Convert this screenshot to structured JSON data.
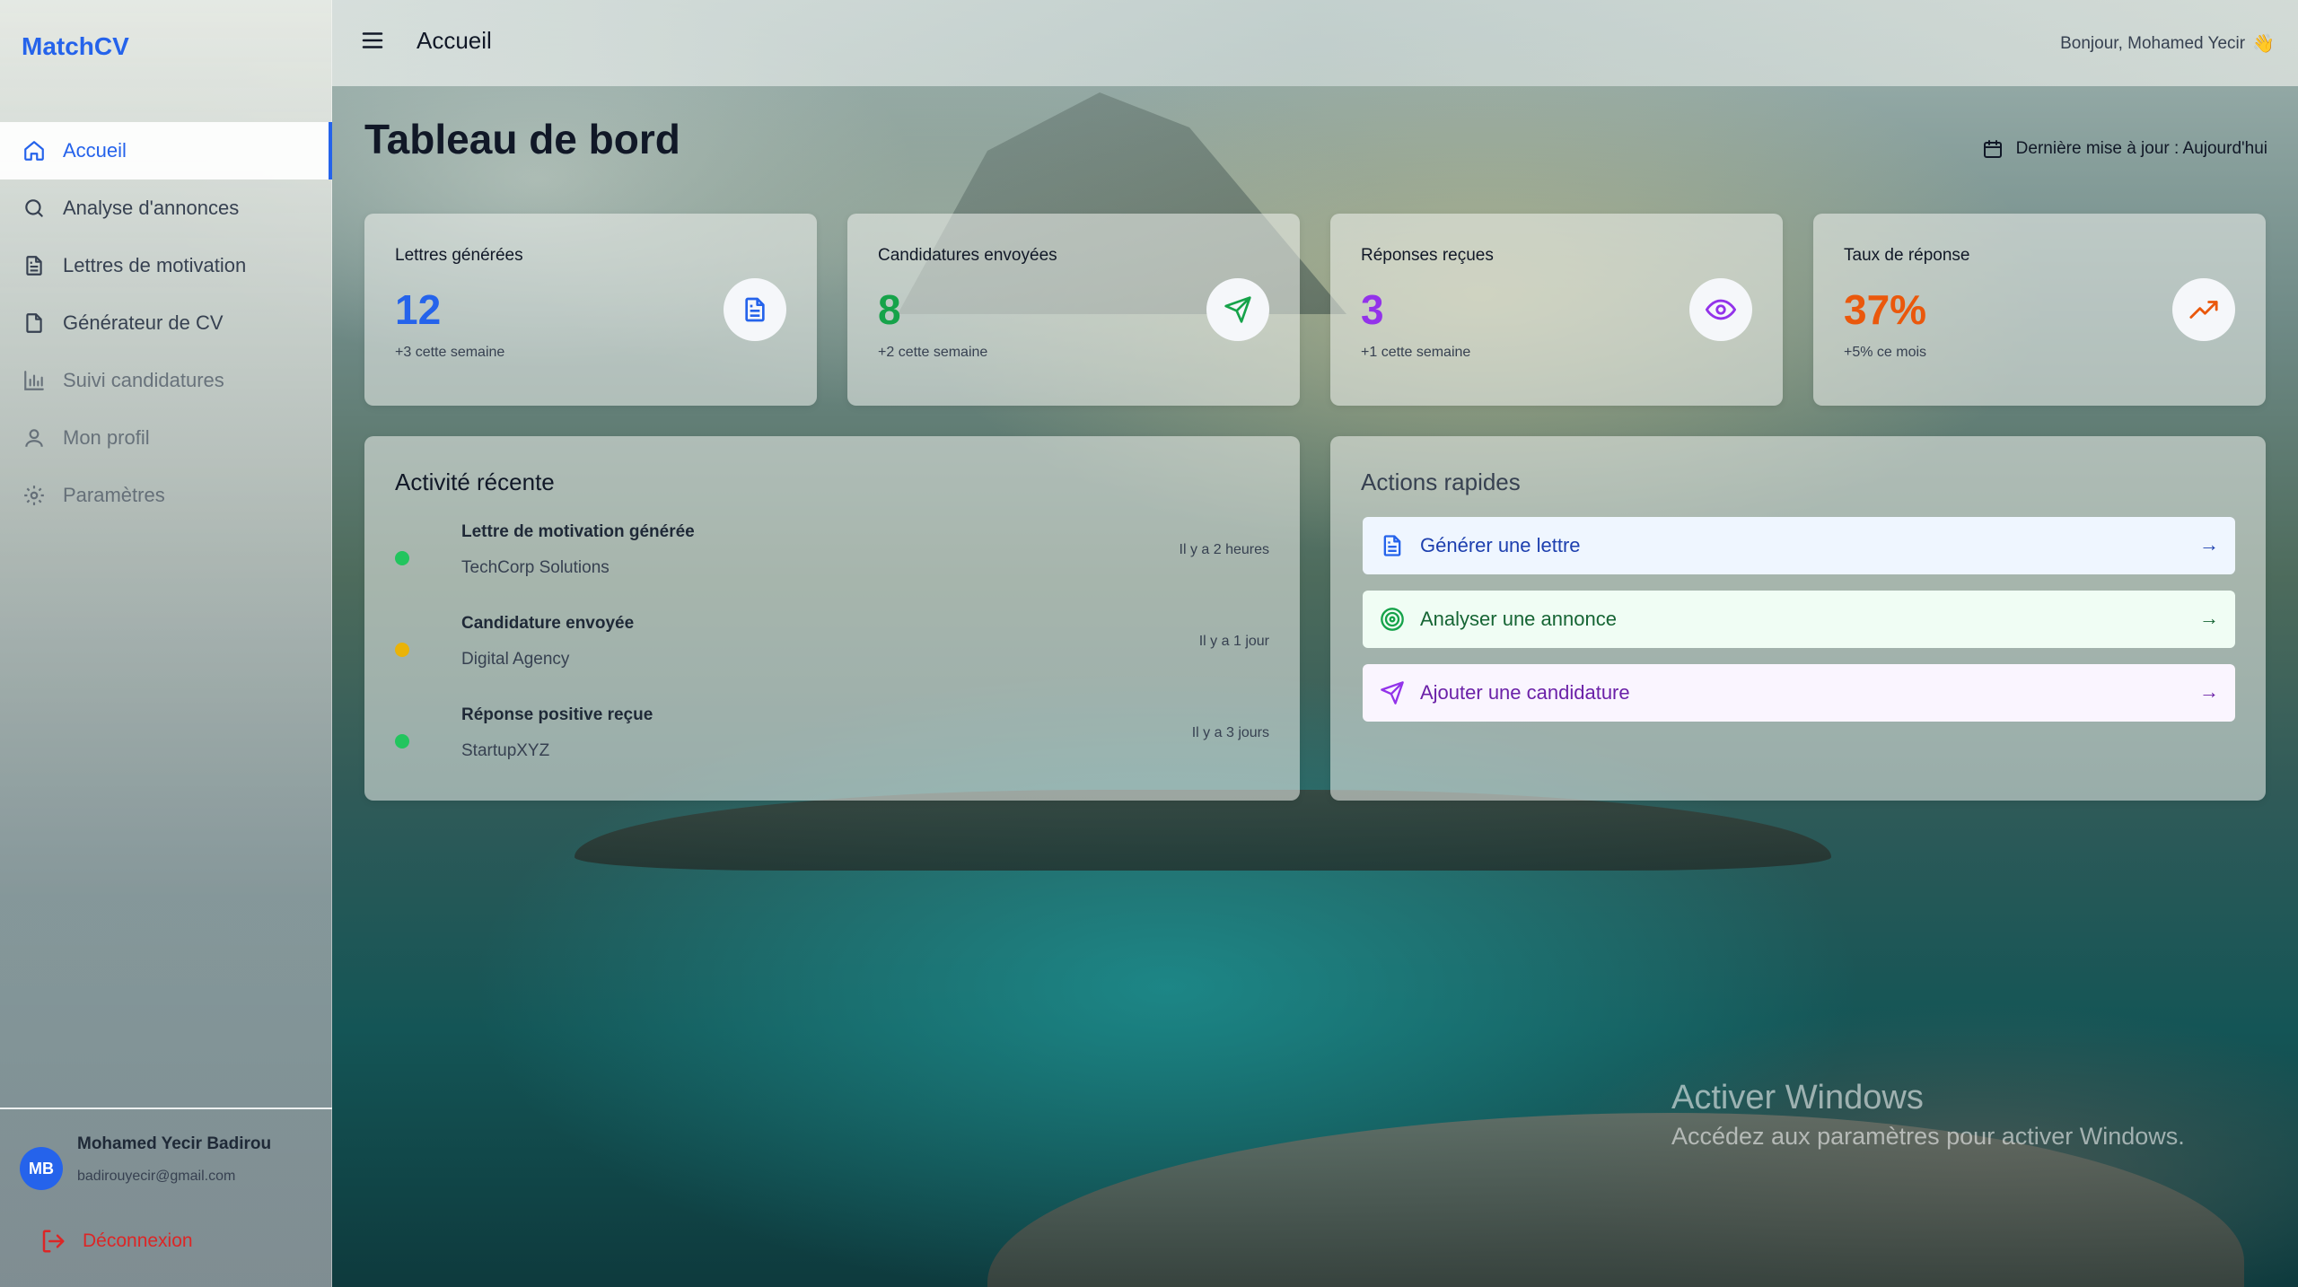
{
  "app": {
    "brand": "MatchCV"
  },
  "sidebar": {
    "items": [
      {
        "label": "Accueil",
        "icon": "home-icon"
      },
      {
        "label": "Analyse d'annonces",
        "icon": "search-icon"
      },
      {
        "label": "Lettres de motivation",
        "icon": "document-icon"
      },
      {
        "label": "Générateur de CV",
        "icon": "file-icon"
      },
      {
        "label": "Suivi candidatures",
        "icon": "bar-chart-icon"
      },
      {
        "label": "Mon profil",
        "icon": "user-icon"
      },
      {
        "label": "Paramètres",
        "icon": "gear-icon"
      }
    ],
    "user": {
      "initials": "MB",
      "name": "Mohamed Yecir Badirou",
      "email": "badirouyecir@gmail.com"
    },
    "logout_label": "Déconnexion"
  },
  "topbar": {
    "title": "Accueil",
    "greeting": "Bonjour, Mohamed Yecir",
    "greeting_emoji": "👋"
  },
  "main": {
    "title": "Tableau de bord",
    "last_update": "Dernière mise à jour : Aujourd'hui",
    "stats": [
      {
        "label": "Lettres générées",
        "value": "12",
        "delta": "+3 cette semaine",
        "color": "#2563eb",
        "icon": "document-icon"
      },
      {
        "label": "Candidatures envoyées",
        "value": "8",
        "delta": "+2 cette semaine",
        "color": "#16a34a",
        "icon": "send-icon"
      },
      {
        "label": "Réponses reçues",
        "value": "3",
        "delta": "+1 cette semaine",
        "color": "#9333ea",
        "icon": "eye-icon"
      },
      {
        "label": "Taux de réponse",
        "value": "37%",
        "delta": "+5% ce mois",
        "color": "#ea580c",
        "icon": "trending-up-icon"
      }
    ],
    "activity": {
      "title": "Activité récente",
      "items": [
        {
          "title": "Lettre de motivation générée",
          "subtitle": "TechCorp Solutions",
          "time": "Il y a 2 heures",
          "dot_color": "#22c55e"
        },
        {
          "title": "Candidature envoyée",
          "subtitle": "Digital Agency",
          "time": "Il y a 1 jour",
          "dot_color": "#eab308"
        },
        {
          "title": "Réponse positive reçue",
          "subtitle": "StartupXYZ",
          "time": "Il y a 3 jours",
          "dot_color": "#22c55e"
        }
      ]
    },
    "quick_actions": {
      "title": "Actions rapides",
      "items": [
        {
          "label": "Générer une lettre",
          "arrow": "→",
          "icon": "document-icon",
          "color": "#1e40af",
          "bg": "#eff6ff"
        },
        {
          "label": "Analyser une annonce",
          "arrow": "→",
          "icon": "target-icon",
          "color": "#166534",
          "bg": "#f0fdf4"
        },
        {
          "label": "Ajouter une candidature",
          "arrow": "→",
          "icon": "send-icon",
          "color": "#6b21a8",
          "bg": "#faf5ff"
        }
      ]
    }
  },
  "watermark": {
    "line1": "Activer Windows",
    "line2": "Accédez aux paramètres pour activer Windows."
  }
}
